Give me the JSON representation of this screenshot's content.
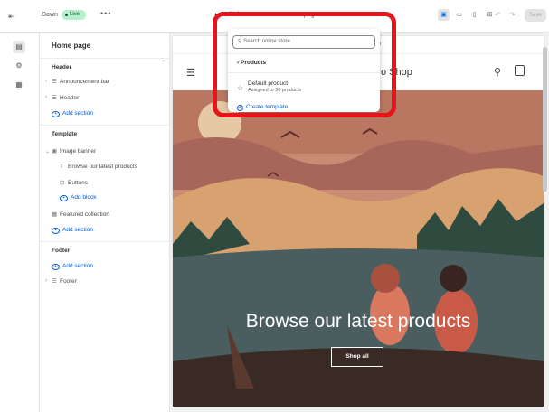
{
  "topbar": {
    "theme_name": "Dawn",
    "live_badge": "Live",
    "more_label": "•••",
    "template_selector": "Default",
    "page_selector": "Home page",
    "save_label": "Save",
    "undo_glyph": "↶",
    "redo_glyph": "↷",
    "icons": [
      "exit-icon",
      "theme-icon",
      "chevron-down-icon",
      "home-icon",
      "inspector-icon",
      "desktop-icon",
      "mobile-icon",
      "fullscreen-icon"
    ]
  },
  "rail": {
    "items": [
      "sections-icon",
      "settings-icon",
      "apps-icon"
    ]
  },
  "sidebar": {
    "title": "Home page",
    "header_group": {
      "label": "Header",
      "items": [
        "Announcement bar",
        "Header"
      ],
      "add_label": "Add section"
    },
    "template_group": {
      "label": "Template",
      "image_banner": "Image banner",
      "banner_blocks": [
        "Browse our latest products",
        "Buttons"
      ],
      "add_block_label": "Add block",
      "featured": "Featured collection",
      "add_label": "Add section"
    },
    "footer_group": {
      "label": "Footer",
      "add_label": "Add section",
      "items": [
        "Footer"
      ]
    }
  },
  "preview": {
    "announcement_text": "re",
    "store_name": "o Shop",
    "banner_heading": "Browse our latest products",
    "banner_button": "Shop all"
  },
  "popover": {
    "search_placeholder": "Search online store",
    "back_label": "Products",
    "item_title": "Default product",
    "item_subtitle": "Assigned to 30 products",
    "create_label": "Create template"
  },
  "colors": {
    "accent": "#005bd3",
    "highlight": "#e8141c",
    "live": "#b4f0c9",
    "banner_sky": "#c88a73",
    "banner_dark": "#3a2a26"
  }
}
